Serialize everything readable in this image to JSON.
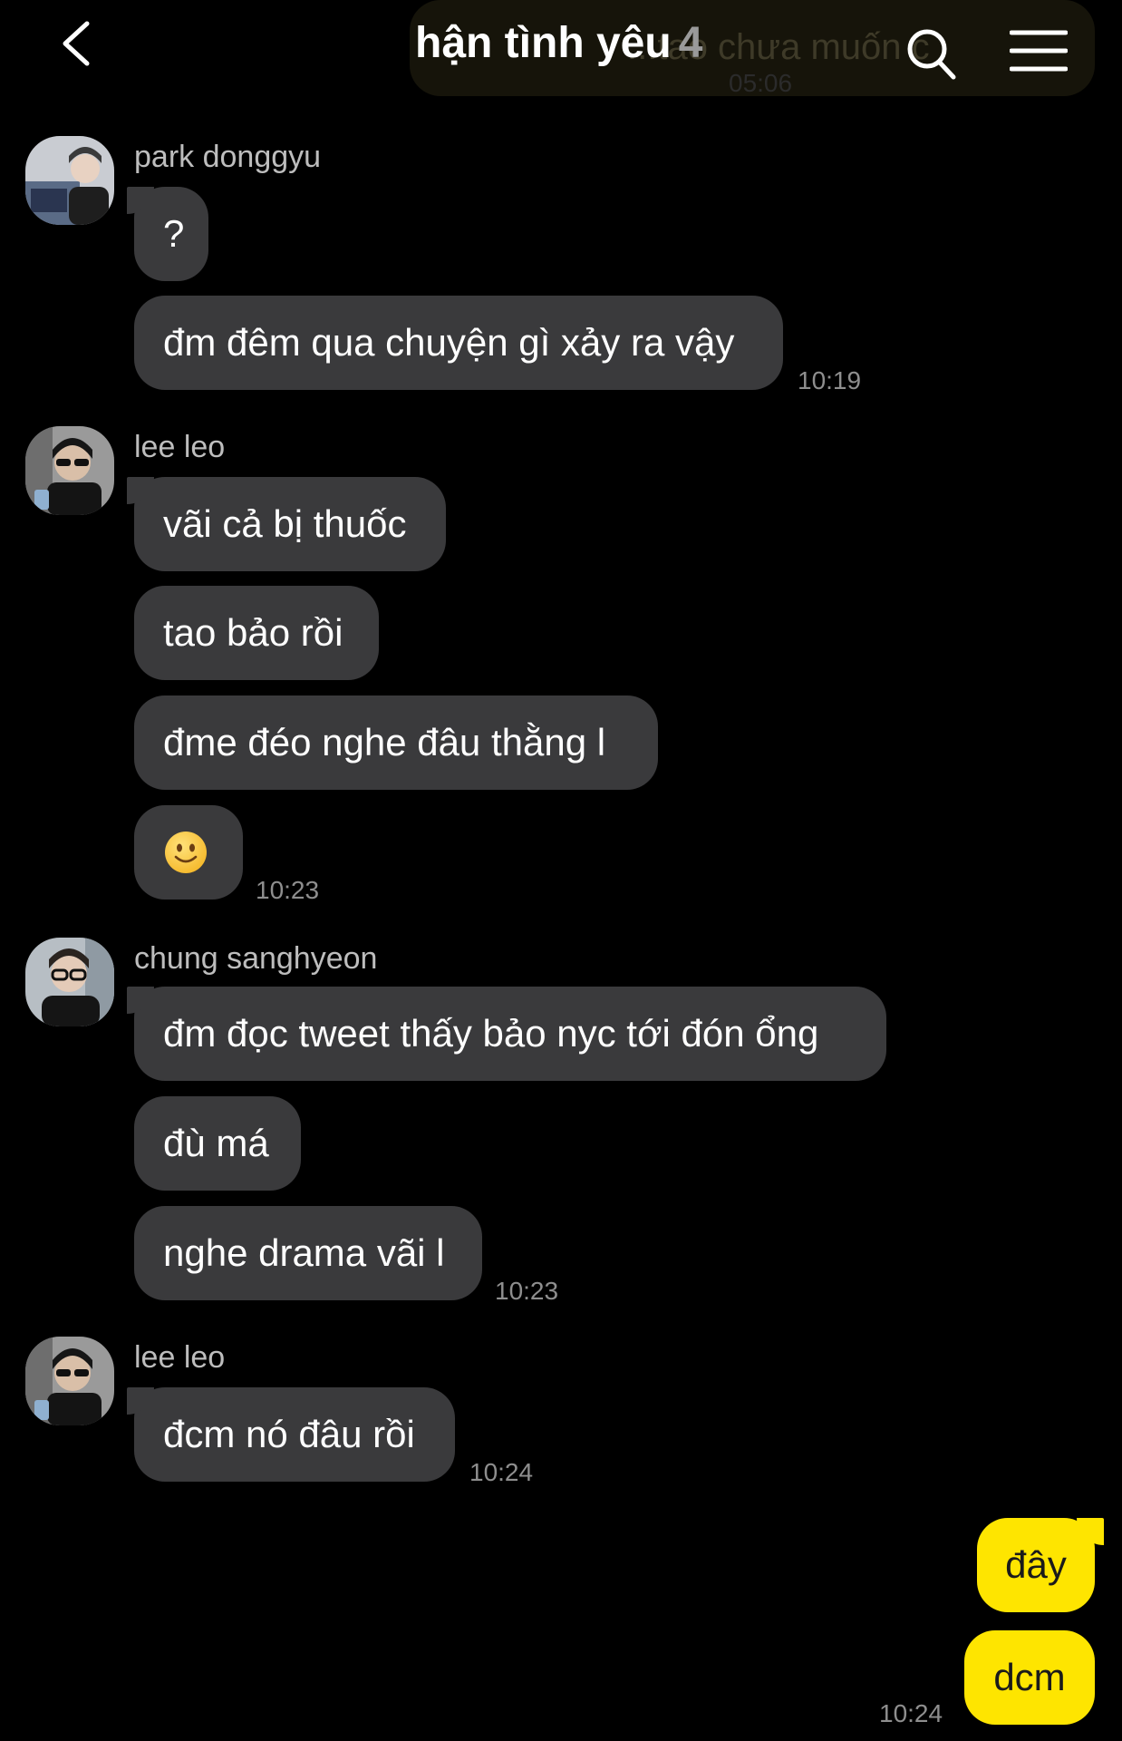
{
  "header": {
    "title": "hận tình yêu",
    "member_count": "4",
    "pinned_preview": "...tao chưa muốn c",
    "pinned_time": "05:06"
  },
  "colors": {
    "background": "#000000",
    "incoming_bubble": "#3a3a3c",
    "outgoing_bubble": "#fee500",
    "timestamp": "#8e8e8e"
  },
  "groups": [
    {
      "sender": "park donggyu",
      "messages": [
        "?",
        "đm đêm qua chuyện gì xảy ra vậy"
      ],
      "time": "10:19"
    },
    {
      "sender": "lee leo",
      "messages": [
        "vãi cả bị thuốc",
        "tao bảo rồi",
        "đme đéo nghe đâu thằng l",
        "slightly-smiling-face-emoji"
      ],
      "time": "10:23"
    },
    {
      "sender": "chung sanghyeon",
      "messages": [
        "đm đọc tweet thấy bảo nyc tới đón ổng",
        "đù má",
        "nghe drama vãi l"
      ],
      "time": "10:23"
    },
    {
      "sender": "lee leo",
      "messages": [
        "đcm nó đâu rồi"
      ],
      "time": "10:24"
    }
  ],
  "my_messages": {
    "messages": [
      "đây",
      "dcm"
    ],
    "time": "10:24"
  }
}
